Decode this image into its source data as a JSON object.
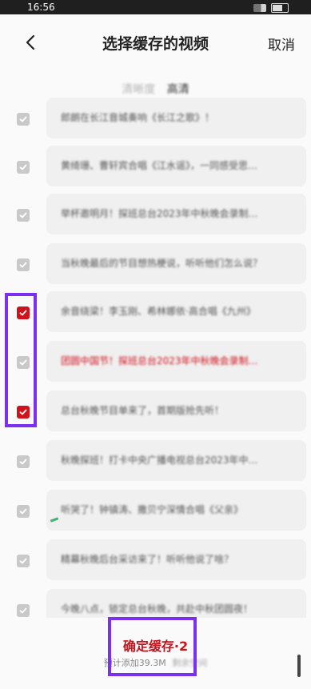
{
  "status": {
    "time": "16:56"
  },
  "header": {
    "title": "选择缓存的视频",
    "cancel_label": "取消"
  },
  "quality": {
    "label": "清晰度",
    "value": "高清"
  },
  "videos": [
    {
      "title": "郎朗在长江音城奏响《长江之歌》！",
      "checked": false
    },
    {
      "title": "黄绮珊、曹轩宾合唱《江水谣》，一同感受思…",
      "checked": false
    },
    {
      "title": "举杯邀明月！探班总台2023年中秋晚会录制…",
      "checked": false
    },
    {
      "title": "当秋晚最后的节目想热梗说，听听他们怎么说？",
      "checked": false
    },
    {
      "title": "余音绕梁！李玉刚、希林娜依·高合唱《九州》",
      "checked": true
    },
    {
      "title": "团圆中国节！探班总台2023年中秋晚会录制…",
      "checked": false,
      "highlight": true
    },
    {
      "title": "总台秋晚节目单来了，首期版抢先听！",
      "checked": true
    },
    {
      "title": "秋晚探班！打卡中央广播电视总台2023年中…",
      "checked": false
    },
    {
      "title": "听哭了！钟镇涛、撒贝宁深情合唱《父亲》",
      "checked": false
    },
    {
      "title": "精幕秋晚后台采访来了！听听他说了啥？",
      "checked": false
    },
    {
      "title": "今晚八点，锁定总台秋晚，共赴中秋团圆夜！",
      "checked": false
    }
  ],
  "footer": {
    "confirm_label": "确定缓存·2",
    "estimate_label": "预计添加39.3M",
    "estimate_extra": "剩余空间"
  },
  "colors": {
    "accent": "#d0121b",
    "highlight": "#7b2ff0"
  }
}
